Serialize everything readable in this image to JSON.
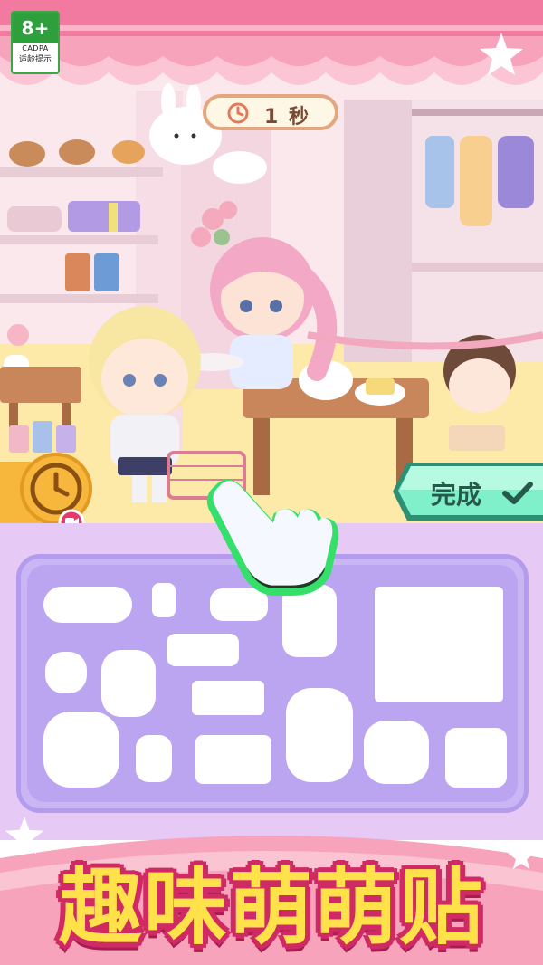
{
  "age_rating": {
    "number": "8+",
    "org": "CADPA",
    "tip": "适龄提示"
  },
  "timer": {
    "value": "1 秒",
    "icon": "clock-icon"
  },
  "buttons": {
    "done_label": "完成",
    "done_icon": "checkmark-icon",
    "time_bonus_icon": "clock-icon",
    "video_icon": "video-icon"
  },
  "title": "趣味萌萌贴",
  "colors": {
    "awning_pink": "#f27aa0",
    "tray_purple": "#cbb6f5",
    "title_yellow": "#ffe24a",
    "title_outline": "#d02a64",
    "done_green": "#5fe0b8"
  }
}
